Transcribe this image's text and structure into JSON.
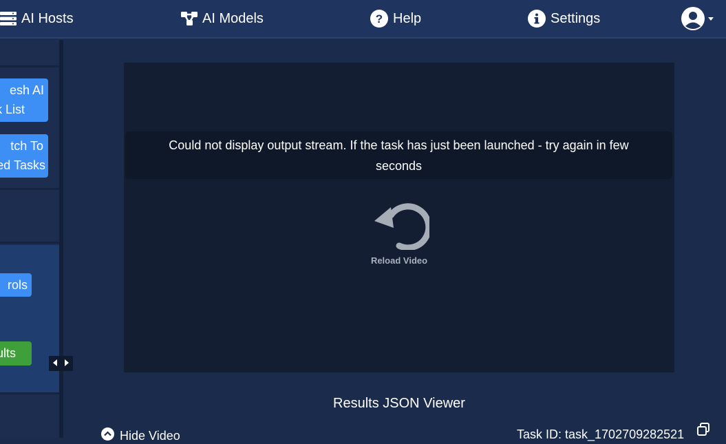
{
  "nav": {
    "ai_hosts": {
      "label": "AI Hosts",
      "icon": "server-icon"
    },
    "ai_models": {
      "label": "AI Models",
      "icon": "network-icon"
    },
    "help": {
      "label": "Help",
      "icon": "question-circle-icon"
    },
    "settings": {
      "label": "Settings",
      "icon": "info-circle-icon"
    },
    "user": {
      "icon": "user-avatar-icon",
      "caret": "caret-down-icon"
    }
  },
  "sidebar": {
    "refresh_button": {
      "line1": "esh AI",
      "line2": "k List"
    },
    "switch_button": {
      "line1": "tch To",
      "line2": "ed Tasks"
    },
    "controls_button": {
      "label": "rols"
    },
    "results_button": {
      "label": "ults"
    }
  },
  "video": {
    "message": "Could not display output stream. If the task has just been launched - try again in few seconds",
    "reload_label": "Reload Video"
  },
  "results": {
    "title": "Results JSON Viewer",
    "hide_video_label": "Hide Video",
    "task_id": "Task ID: task_1702709282521"
  },
  "colors": {
    "background": "#1b2b4b",
    "navbar": "#1f3560",
    "video_bg": "#131e33",
    "blue_button": "#3d8ef5",
    "green_button": "#3fa03b"
  }
}
